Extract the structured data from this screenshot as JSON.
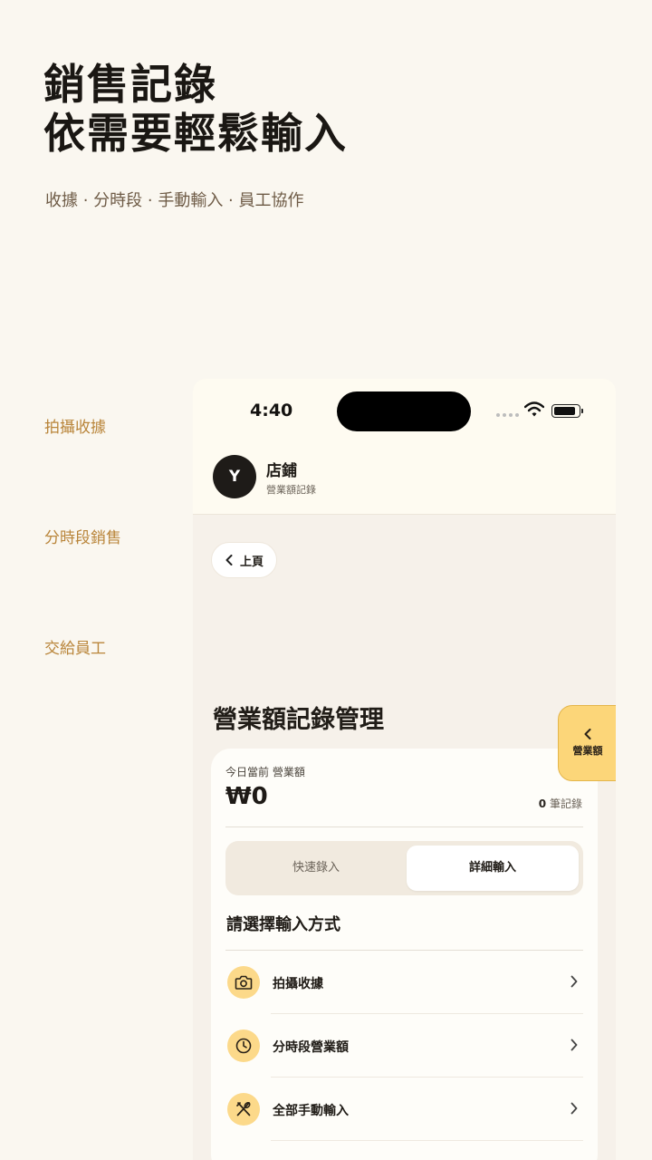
{
  "hero": {
    "title_line1": "銷售記錄",
    "title_line2": "依需要輕鬆輸入",
    "subtitle": "收據 ·   分時段 ·   手動輸入 ·   員工協作"
  },
  "features": [
    {
      "label": "拍攝收據"
    },
    {
      "label": "分時段銷售"
    },
    {
      "label": "交給員工"
    }
  ],
  "phone": {
    "status": {
      "time": "4:40"
    },
    "header": {
      "avatar_letter": "Y",
      "store_name": "店鋪",
      "store_sub": "營業額記錄"
    },
    "back_label": "上頁",
    "page_title": "營業額記錄管理",
    "fab_label": "營業額",
    "card": {
      "today_label": "今日當前 營業額",
      "amount": "₩0",
      "count_value": "0",
      "count_unit": "筆記錄",
      "tabs": [
        {
          "label": "快速錄入",
          "selected": false
        },
        {
          "label": "詳細輸入",
          "selected": true
        }
      ],
      "section_title": "請選擇輸入方式",
      "options": [
        {
          "label": "拍攝收據",
          "icon": "camera-icon"
        },
        {
          "label": "分時段營業額",
          "icon": "clock-icon"
        },
        {
          "label": "全部手動輸入",
          "icon": "utensils-icon"
        }
      ]
    }
  },
  "colors": {
    "background": "#FAF7F0",
    "accent": "#FCD679",
    "feature_label": "#B9853A",
    "dark": "#1E1B18"
  }
}
